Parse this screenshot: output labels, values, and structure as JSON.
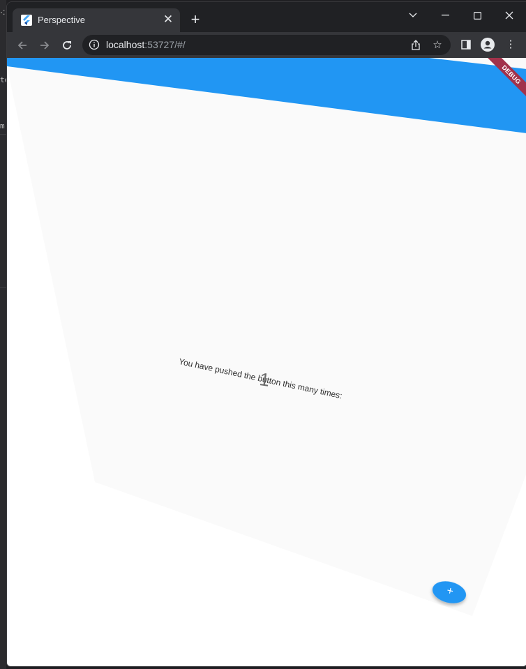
{
  "browser": {
    "tab": {
      "title": "Perspective"
    },
    "address_bar": {
      "host": "localhost",
      "rest": ":53727/#/"
    }
  },
  "app": {
    "debug_banner": "DEBUG",
    "counter_label": "You have pushed the button this many times:",
    "counter_value": "1",
    "fab_icon": "+"
  },
  "icons": {
    "tab_favicon": "flutter-icon",
    "tab_close": "close-icon",
    "new_tab": "plus-icon",
    "back": "arrow-left-icon",
    "forward": "arrow-right-icon",
    "reload": "reload-icon",
    "site_info": "info-icon",
    "share": "share-icon",
    "bookmark": "star-icon",
    "side_panel": "side-panel-icon",
    "profile": "profile-icon",
    "menu": "kebab-menu-icon",
    "tab_search": "chevron-down-icon",
    "minimize": "minimize-icon",
    "maximize": "maximize-icon",
    "close_window": "close-icon"
  },
  "colors": {
    "app_bar": "#2196f3",
    "page_surface": "#fafafa",
    "fab": "#2196f3",
    "debug_banner": "#a2324b"
  }
}
